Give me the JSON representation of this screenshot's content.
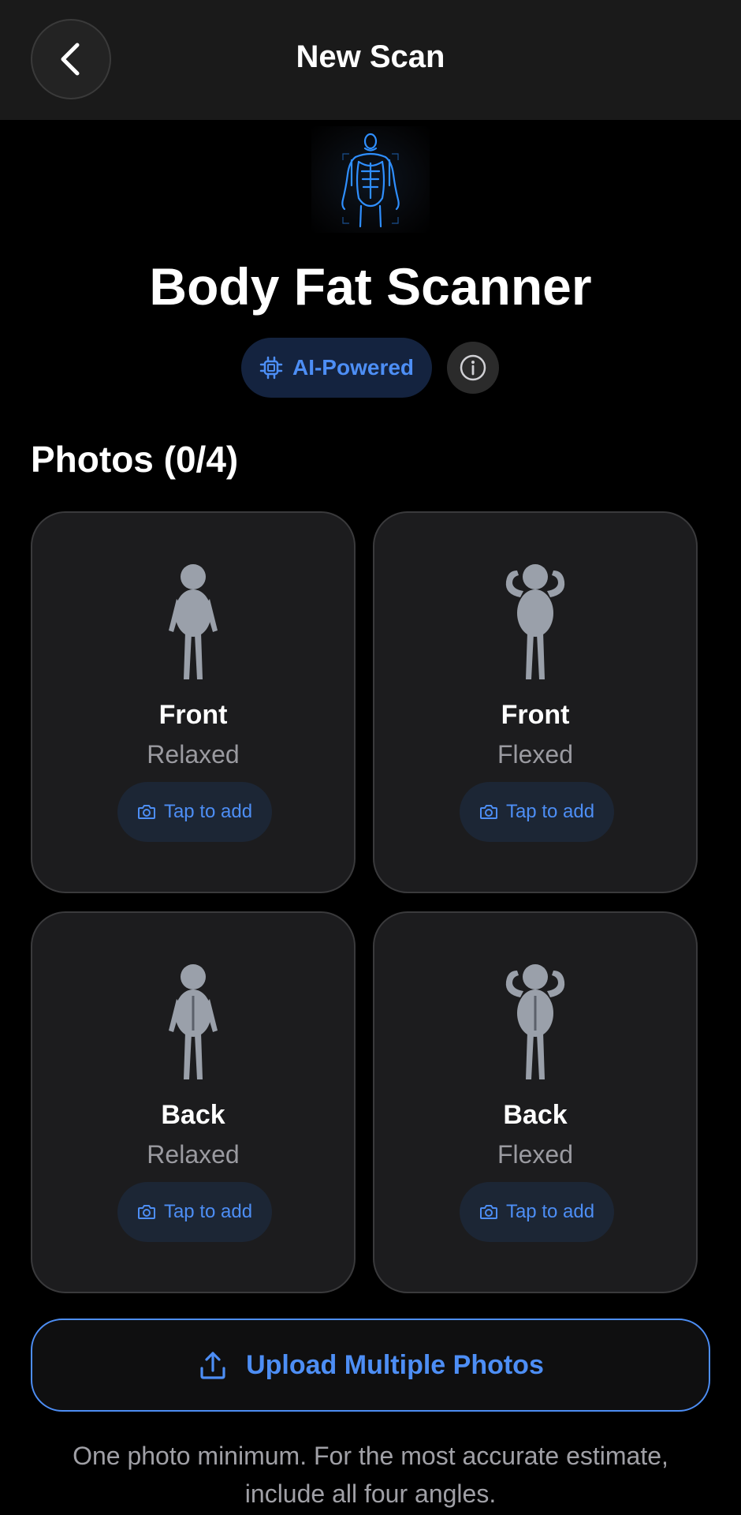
{
  "header": {
    "title": "New Scan"
  },
  "hero": {
    "title": "Body Fat Scanner",
    "badge_label": "AI-Powered"
  },
  "photos": {
    "section_title": "Photos (0/4)",
    "cards": [
      {
        "title": "Front",
        "subtitle": "Relaxed",
        "action": "Tap to add"
      },
      {
        "title": "Front",
        "subtitle": "Flexed",
        "action": "Tap to add"
      },
      {
        "title": "Back",
        "subtitle": "Relaxed",
        "action": "Tap to add"
      },
      {
        "title": "Back",
        "subtitle": "Flexed",
        "action": "Tap to add"
      }
    ]
  },
  "upload": {
    "label": "Upload Multiple Photos"
  },
  "footnote": "One photo minimum. For the most accurate estimate, include all four angles.",
  "colors": {
    "accent": "#4d8ef5",
    "background": "#000000",
    "card": "#1c1c1e",
    "figure": "#9aa0aa"
  },
  "icons": {
    "back": "chevron-left-icon",
    "badge": "chip-icon",
    "info": "info-icon",
    "camera": "camera-icon",
    "upload": "upload-icon",
    "hero": "body-scan-figure"
  }
}
